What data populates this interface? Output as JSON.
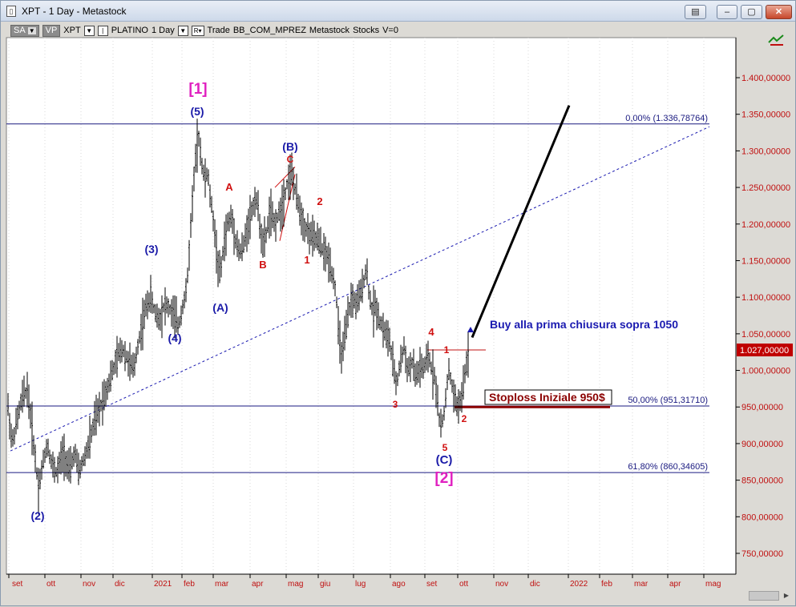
{
  "window": {
    "title": "XPT - 1 Day - Metastock",
    "app_icon": "document-icon"
  },
  "toolbar": {
    "sa_label": "SA",
    "vp_label": "VP",
    "symbol": "XPT",
    "name": "PLATINO",
    "period": "1 Day",
    "r_label": "R",
    "mode": "Trade",
    "security": "BB_COM_MPREZ",
    "source": "Metastock",
    "type": "Stocks",
    "volume": "V=0"
  },
  "chart_data": {
    "type": "candlestick",
    "x_ticks": [
      "set",
      "ott",
      "nov",
      "dic",
      "2021",
      "feb",
      "mar",
      "apr",
      "mag",
      "giu",
      "lug",
      "ago",
      "set",
      "ott",
      "nov",
      "dic",
      "2022",
      "feb",
      "mar",
      "apr",
      "mag"
    ],
    "y_ticks": [
      "1.400,00000",
      "1.350,00000",
      "1.300,00000",
      "1.250,00000",
      "1.200,00000",
      "1.150,00000",
      "1.100,00000",
      "1.050,00000",
      "1.000,00000",
      "950,00000",
      "900,00000",
      "850,00000",
      "800,00000",
      "750,00000"
    ],
    "ylim": [
      710,
      1440
    ],
    "last_price": "1.027,00000",
    "fib_levels": [
      {
        "label": "0,00% (1.336,78764)",
        "value": 1336.78764
      },
      {
        "label": "50,00% (951,31710)",
        "value": 951.3171
      },
      {
        "label": "61,80% (860,34605)",
        "value": 860.34605
      }
    ],
    "wave_labels": [
      {
        "text": "[1]",
        "color": "#e020c0"
      },
      {
        "text": "(5)",
        "color": "#1a1aa8"
      },
      {
        "text": "(B)",
        "color": "#1a1aa8"
      },
      {
        "text": "C",
        "color": "#d01010"
      },
      {
        "text": "A",
        "color": "#d01010"
      },
      {
        "text": "2",
        "color": "#d01010"
      },
      {
        "text": "(3)",
        "color": "#1a1aa8"
      },
      {
        "text": "B",
        "color": "#d01010"
      },
      {
        "text": "1",
        "color": "#d01010"
      },
      {
        "text": "(A)",
        "color": "#1a1aa8"
      },
      {
        "text": "(4)",
        "color": "#1a1aa8"
      },
      {
        "text": "4",
        "color": "#d01010"
      },
      {
        "text": "1",
        "color": "#d01010"
      },
      {
        "text": "3",
        "color": "#d01010"
      },
      {
        "text": "2",
        "color": "#d01010"
      },
      {
        "text": "5",
        "color": "#d01010"
      },
      {
        "text": "(C)",
        "color": "#1a1aa8"
      },
      {
        "text": "[2]",
        "color": "#e020c0"
      },
      {
        "text": "(2)",
        "color": "#1a1aa8"
      }
    ],
    "annotations": {
      "buy_text": "Buy alla prima chiusura sopra 1050",
      "stoploss_text": "Stoploss Iniziale 950$"
    },
    "colors": {
      "price": "#000000",
      "fib_line": "#1a1a80",
      "trend_line": "#1a1ab0",
      "axis_text": "#c01010",
      "last_price_bg": "#c00000",
      "stoploss_band": "#8b0000",
      "buy_text": "#1a1ab0"
    }
  }
}
